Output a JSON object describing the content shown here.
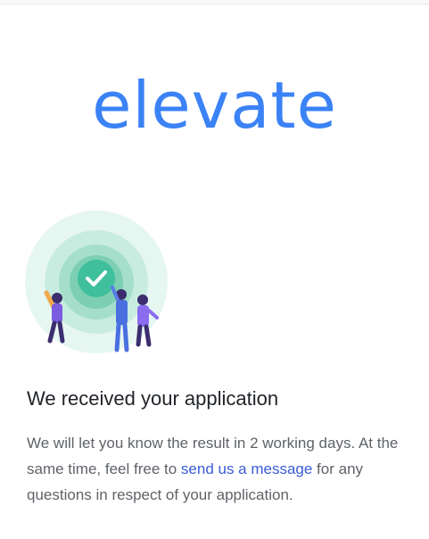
{
  "brand": {
    "logo_text": "elevate",
    "color": "#3b82f6"
  },
  "status": {
    "icon": "check-circle-icon",
    "illustration": "people-celebrating-illustration",
    "accent_color": "#3fbf9b"
  },
  "confirmation": {
    "title": "We received your application",
    "message_part1": "We will let you know the result in 2 working days. At the same time, feel free to ",
    "link_text": "send us a message",
    "message_part2": " for any questions in respect of your application."
  }
}
